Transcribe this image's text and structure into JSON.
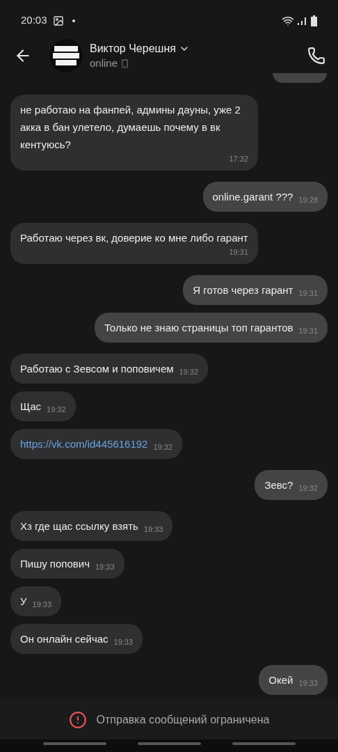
{
  "status_bar": {
    "time": "20:03"
  },
  "header": {
    "contact_name": "Виктор Черешня",
    "presence": "online"
  },
  "messages": [
    {
      "kind": "text",
      "outgoing": false,
      "text": "не работаю на фанпей, админы дауны, уже 2 акка в бан улетело, думаешь почему в вк кентуюсь?",
      "time": "17:32"
    },
    {
      "kind": "text",
      "outgoing": true,
      "text": "online.garant ???",
      "time": "19:28"
    },
    {
      "kind": "text",
      "outgoing": false,
      "text": "Работаю через вк, доверие ко мне либо гарант",
      "time": "19:31"
    },
    {
      "kind": "text",
      "outgoing": true,
      "text": "Я готов через гарант",
      "time": "19:31"
    },
    {
      "kind": "text",
      "outgoing": true,
      "text": "Только не знаю страницы топ гарантов",
      "time": "19:31"
    },
    {
      "kind": "text",
      "outgoing": false,
      "text": "Работаю с Зевсом и поповичем",
      "time": "19:32"
    },
    {
      "kind": "text",
      "outgoing": false,
      "text": "Щас",
      "time": "19:32"
    },
    {
      "kind": "link",
      "outgoing": false,
      "text": "https://vk.com/id445616192",
      "time": "19:32"
    },
    {
      "kind": "text",
      "outgoing": true,
      "text": "Зевс?",
      "time": "19:32"
    },
    {
      "kind": "text",
      "outgoing": false,
      "text": "Хз где щас ссылку взять",
      "time": "19:33"
    },
    {
      "kind": "text",
      "outgoing": false,
      "text": "Пишу попович",
      "time": "19:33"
    },
    {
      "kind": "text",
      "outgoing": false,
      "text": "У",
      "time": "19:33"
    },
    {
      "kind": "text",
      "outgoing": false,
      "text": "Он онлайн сейчас",
      "time": "19:33"
    },
    {
      "kind": "text",
      "outgoing": true,
      "text": "Окей",
      "time": "19:33"
    }
  ],
  "notice": {
    "text": "Отправка сообщений ограничена"
  }
}
